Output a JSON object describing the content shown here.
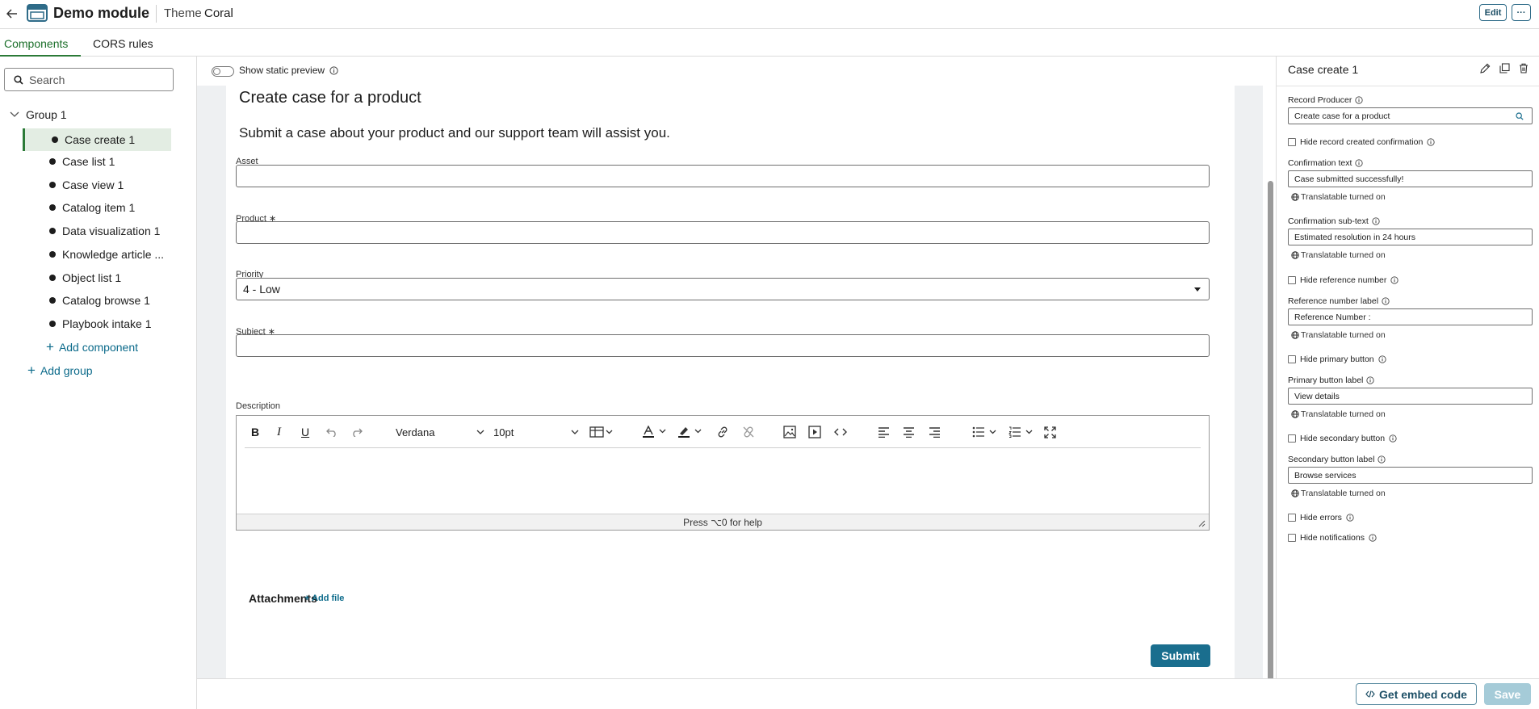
{
  "header": {
    "back_icon": "arrow-left-icon",
    "module_icon": "window-module-icon",
    "module_title": "Demo module",
    "theme_label": "Theme",
    "theme_value": "Coral",
    "edit_label": "Edit",
    "more_label": "···"
  },
  "tabs": [
    {
      "label": "Components",
      "active": true
    },
    {
      "label": "CORS rules",
      "active": false
    }
  ],
  "sidebar": {
    "search_placeholder": "Search",
    "group_label": "Group 1",
    "items": [
      {
        "label": "Case create 1",
        "selected": true
      },
      {
        "label": "Case list 1"
      },
      {
        "label": "Case view 1"
      },
      {
        "label": "Catalog item 1"
      },
      {
        "label": "Data visualization 1"
      },
      {
        "label": "Knowledge article ..."
      },
      {
        "label": "Object list 1"
      },
      {
        "label": "Catalog browse 1"
      },
      {
        "label": "Playbook intake 1"
      }
    ],
    "add_component": "Add component",
    "add_group": "Add group"
  },
  "preview": {
    "static_label": "Show static preview"
  },
  "form": {
    "title": "Create case for a product",
    "subtitle": "Submit a case about your product and our support team will assist you.",
    "asset_label": "Asset",
    "product_label": "Product",
    "required_mark": "∗",
    "priority_label": "Priority",
    "priority_value": "4 - Low",
    "subject_label": "Subject",
    "description_label": "Description",
    "editor": {
      "font": "Verdana",
      "size": "10pt",
      "status": "Press ⌥0 for help"
    },
    "attachments_label": "Attachments",
    "add_file": "+ Add file",
    "submit": "Submit"
  },
  "props": {
    "title": "Case create 1",
    "record_producer_label": "Record Producer",
    "record_producer_value": "Create case for a product",
    "hide_record_confirmation": "Hide record created confirmation",
    "confirmation_text_label": "Confirmation text",
    "confirmation_text_value": "Case submitted successfully!",
    "translatable": "Translatable turned on",
    "confirmation_subtext_label": "Confirmation sub-text",
    "confirmation_subtext_value": "Estimated resolution in 24 hours",
    "hide_reference_number": "Hide reference number",
    "reference_number_label": "Reference number label",
    "reference_number_value": "Reference Number :",
    "hide_primary_button": "Hide primary button",
    "primary_button_label": "Primary button label",
    "primary_button_value": "View details",
    "hide_secondary_button": "Hide secondary button",
    "secondary_button_label": "Secondary button label",
    "secondary_button_value": "Browse services",
    "hide_errors": "Hide errors",
    "hide_notifications": "Hide notifications"
  },
  "footer": {
    "embed_label": "Get embed code",
    "save_label": "Save"
  },
  "colors": {
    "accent_green": "#2b7a37",
    "primary_blue": "#1a6e8e",
    "selected_bg": "#e3ede3"
  }
}
